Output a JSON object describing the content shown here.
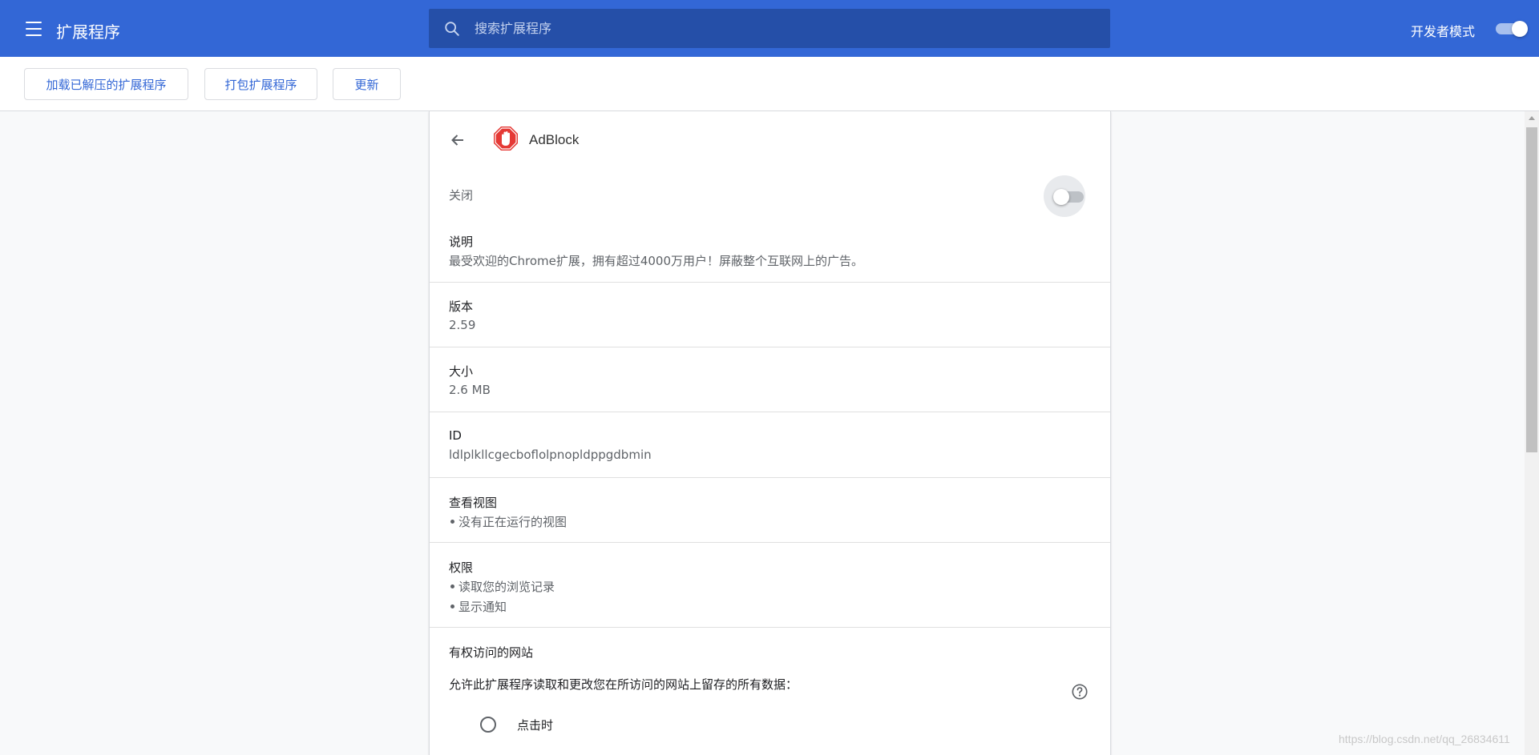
{
  "header": {
    "title": "扩展程序",
    "search_placeholder": "搜索扩展程序",
    "dev_mode_label": "开发者模式",
    "dev_mode_on": true
  },
  "toolbar": {
    "load_unpacked": "加载已解压的扩展程序",
    "pack": "打包扩展程序",
    "update": "更新"
  },
  "extension": {
    "name": "AdBlock",
    "enabled_label": "关闭",
    "enabled": false,
    "description_title": "说明",
    "description": "最受欢迎的Chrome扩展，拥有超过4000万用户！屏蔽整个互联网上的广告。",
    "version_title": "版本",
    "version": "2.59",
    "size_title": "大小",
    "size": "2.6 MB",
    "id_title": "ID",
    "id": "ldlplkllcgecboflolpnopldppgdbmin",
    "views_title": "查看视图",
    "views": [
      "没有正在运行的视图"
    ],
    "permissions_title": "权限",
    "permissions": [
      "读取您的浏览记录",
      "显示通知"
    ],
    "site_access_title": "有权访问的网站",
    "site_access_desc": "允许此扩展程序读取和更改您在所访问的网站上留存的所有数据：",
    "site_access_option_1": "点击时"
  },
  "watermark": "https://blog.csdn.net/qq_26834611",
  "colors": {
    "header_bg": "#3367d6",
    "search_bg": "#254fa8",
    "accent": "#3367d6"
  }
}
